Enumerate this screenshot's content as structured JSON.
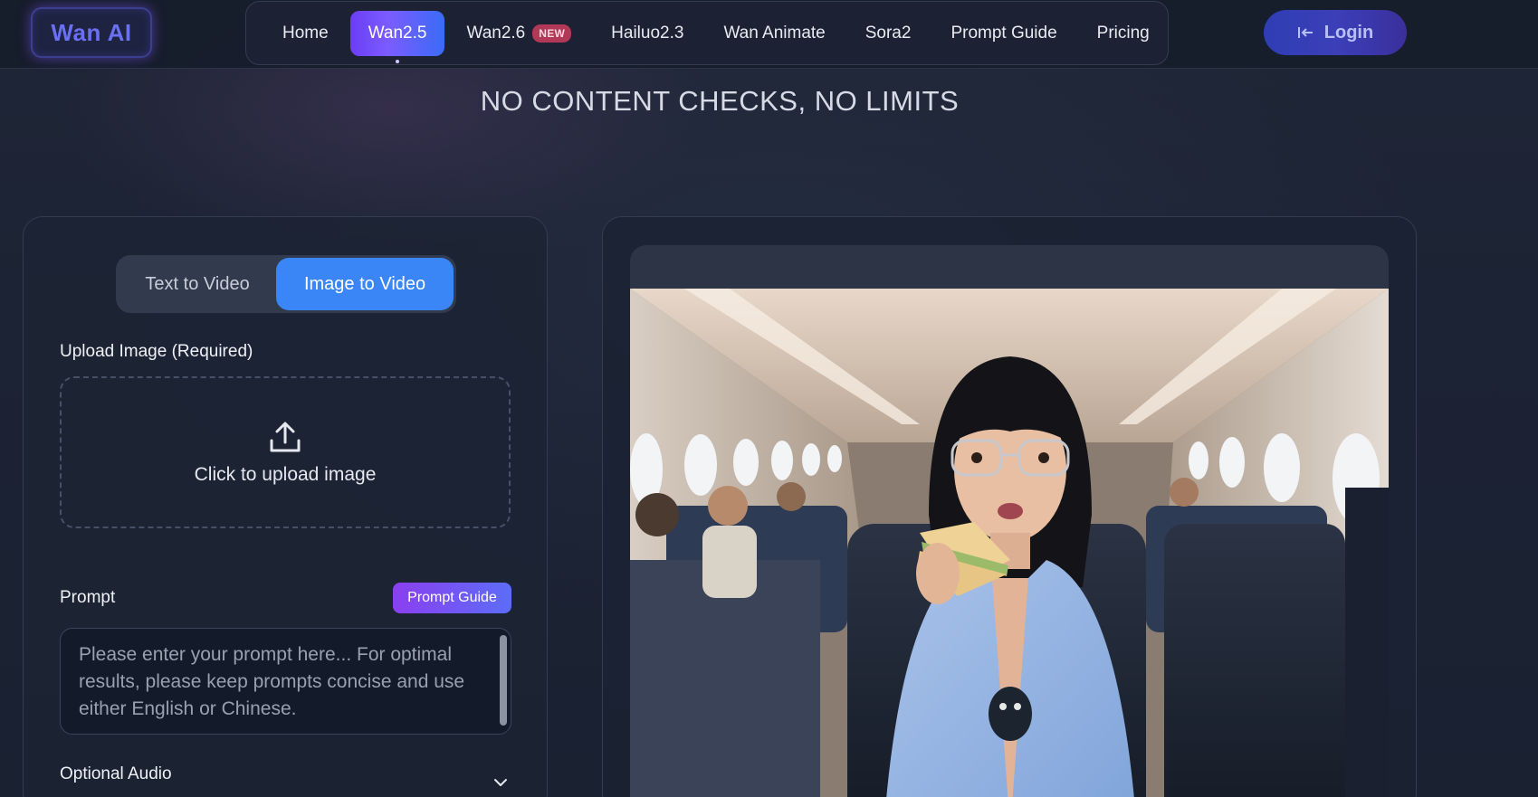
{
  "header": {
    "logo": "Wan AI",
    "nav": [
      {
        "label": "Home"
      },
      {
        "label": "Wan2.5",
        "active": true
      },
      {
        "label": "Wan2.6",
        "badge": "NEW"
      },
      {
        "label": "Hailuo2.3"
      },
      {
        "label": "Wan Animate"
      },
      {
        "label": "Sora2"
      },
      {
        "label": "Prompt Guide"
      },
      {
        "label": "Pricing"
      }
    ],
    "login_label": "Login",
    "login_icon": "login-arrow-icon"
  },
  "hero": {
    "tagline": "NO CONTENT CHECKS, NO LIMITS"
  },
  "generator": {
    "modes": {
      "text_to_video": "Text to Video",
      "image_to_video": "Image to Video",
      "selected": "Image to Video"
    },
    "upload_label": "Upload Image (Required)",
    "upload_text": "Click to upload image",
    "upload_icon": "upload-icon",
    "prompt_label": "Prompt",
    "prompt_guide_label": "Prompt Guide",
    "prompt_placeholder": "Please enter your prompt here... For optimal results, please keep prompts concise and use either English or Chinese.",
    "audio_label": "Optional Audio",
    "audio_icon": "chevron-down-icon"
  },
  "colors": {
    "accent_purple": "#7b5cff",
    "accent_blue": "#3a86f7",
    "badge_red": "#b23857",
    "background": "#1b2232"
  }
}
